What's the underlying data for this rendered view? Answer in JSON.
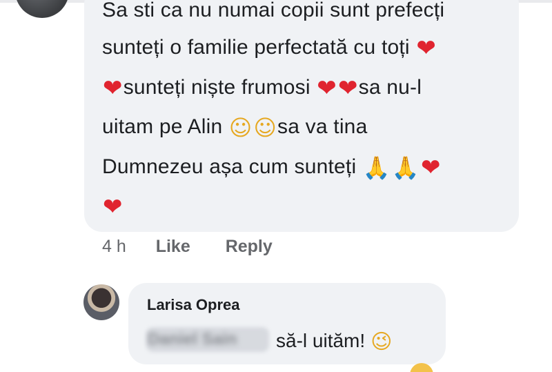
{
  "main_comment": {
    "lines": [
      "Sa sti ca nu numai copii sunt prefecți",
      "sunteți o familie perfectată cu toți",
      "sunteți niște frumosi",
      "sa nu-l",
      "uitam pe Alin",
      "sa va tina",
      "Dumnezeu așa cum sunteți"
    ],
    "emoji": {
      "heart": "❤",
      "smile": "☺",
      "pray": "🙏"
    }
  },
  "actions": {
    "time": "4 h",
    "like": "Like",
    "reply": "Reply"
  },
  "reply": {
    "author": "Larisa Oprea",
    "mention": "Daniel Sain",
    "text": "să-l uităm!",
    "emoji": "😉"
  },
  "colors": {
    "bubble": "#f0f2f5",
    "text": "#1c1e21",
    "meta": "#65676b",
    "heart": "#e0242f"
  }
}
